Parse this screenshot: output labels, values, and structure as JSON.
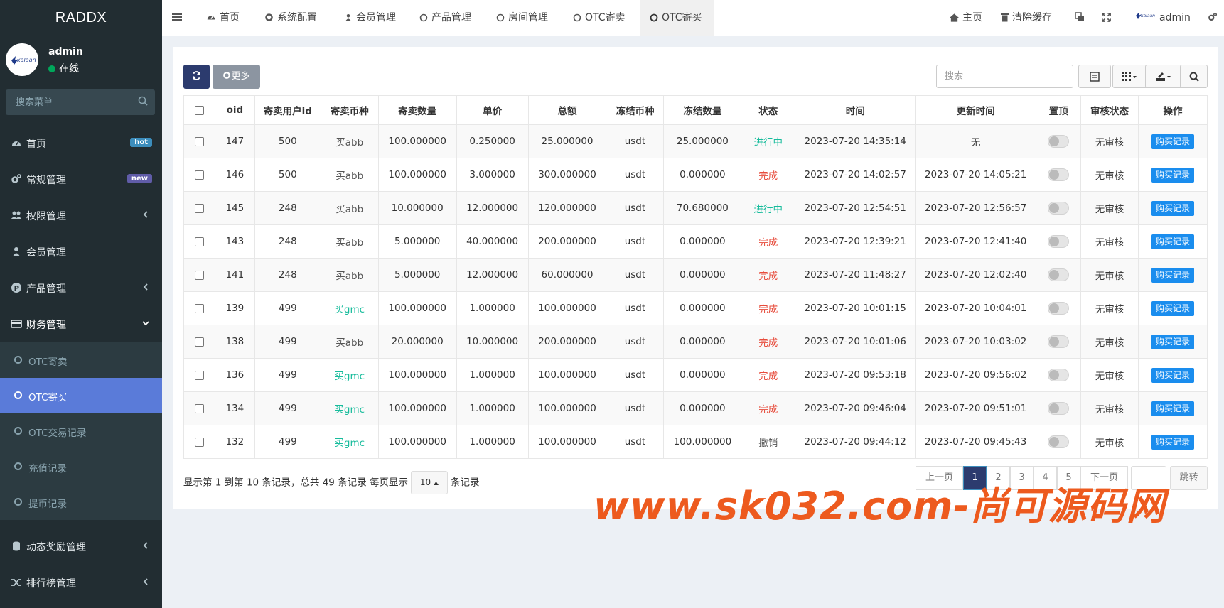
{
  "app": {
    "title": "RADDX"
  },
  "user": {
    "name": "admin",
    "status": "在线"
  },
  "sidebar": {
    "search_placeholder": "搜索菜单",
    "items": [
      {
        "label": "首页",
        "badge": "hot",
        "badge_color": "#3c8dbc"
      },
      {
        "label": "常规管理",
        "badge": "new",
        "badge_color": "#605ca8"
      },
      {
        "label": "权限管理"
      },
      {
        "label": "会员管理"
      },
      {
        "label": "产品管理"
      },
      {
        "label": "财务管理"
      }
    ],
    "sub_items": [
      {
        "label": "OTC寄卖"
      },
      {
        "label": "OTC寄买"
      },
      {
        "label": "OTC交易记录"
      },
      {
        "label": "充值记录"
      },
      {
        "label": "提币记录"
      }
    ],
    "bottom_items": [
      {
        "label": "动态奖励管理"
      },
      {
        "label": "排行榜管理"
      }
    ]
  },
  "topnav": {
    "tabs": [
      {
        "label": "首页"
      },
      {
        "label": "系统配置"
      },
      {
        "label": "会员管理"
      },
      {
        "label": "产品管理"
      },
      {
        "label": "房间管理"
      },
      {
        "label": "OTC寄卖"
      },
      {
        "label": "OTC寄买"
      }
    ],
    "right": {
      "home": "主页",
      "clear_cache": "清除缓存",
      "user": "admin"
    }
  },
  "toolbar": {
    "more_label": "更多",
    "search_placeholder": "搜索"
  },
  "table": {
    "headers": [
      "oid",
      "寄卖用户id",
      "寄卖币种",
      "寄卖数量",
      "单价",
      "总额",
      "冻结币种",
      "冻结数量",
      "状态",
      "时间",
      "更新时间",
      "置顶",
      "审核状态",
      "操作"
    ],
    "rows": [
      {
        "oid": "147",
        "uid": "500",
        "coin": "买abb",
        "coin_type": "abb",
        "qty": "100.000000",
        "price": "0.250000",
        "total": "25.000000",
        "fcoin": "usdt",
        "fqty": "25.000000",
        "status": "进行中",
        "status_type": "progress",
        "time": "2023-07-20 14:35:14",
        "utime": "无",
        "audit": "无审核",
        "op": "购买记录"
      },
      {
        "oid": "146",
        "uid": "500",
        "coin": "买abb",
        "coin_type": "abb",
        "qty": "100.000000",
        "price": "3.000000",
        "total": "300.000000",
        "fcoin": "usdt",
        "fqty": "0.000000",
        "status": "完成",
        "status_type": "done",
        "time": "2023-07-20 14:02:57",
        "utime": "2023-07-20 14:05:21",
        "audit": "无审核",
        "op": "购买记录"
      },
      {
        "oid": "145",
        "uid": "248",
        "coin": "买abb",
        "coin_type": "abb",
        "qty": "10.000000",
        "price": "12.000000",
        "total": "120.000000",
        "fcoin": "usdt",
        "fqty": "70.680000",
        "status": "进行中",
        "status_type": "progress",
        "time": "2023-07-20 12:54:51",
        "utime": "2023-07-20 12:56:57",
        "audit": "无审核",
        "op": "购买记录"
      },
      {
        "oid": "143",
        "uid": "248",
        "coin": "买abb",
        "coin_type": "abb",
        "qty": "5.000000",
        "price": "40.000000",
        "total": "200.000000",
        "fcoin": "usdt",
        "fqty": "0.000000",
        "status": "完成",
        "status_type": "done",
        "time": "2023-07-20 12:39:21",
        "utime": "2023-07-20 12:41:40",
        "audit": "无审核",
        "op": "购买记录"
      },
      {
        "oid": "141",
        "uid": "248",
        "coin": "买abb",
        "coin_type": "abb",
        "qty": "5.000000",
        "price": "12.000000",
        "total": "60.000000",
        "fcoin": "usdt",
        "fqty": "0.000000",
        "status": "完成",
        "status_type": "done",
        "time": "2023-07-20 11:48:27",
        "utime": "2023-07-20 12:02:40",
        "audit": "无审核",
        "op": "购买记录"
      },
      {
        "oid": "139",
        "uid": "499",
        "coin": "买gmc",
        "coin_type": "gmc",
        "qty": "100.000000",
        "price": "1.000000",
        "total": "100.000000",
        "fcoin": "usdt",
        "fqty": "0.000000",
        "status": "完成",
        "status_type": "done",
        "time": "2023-07-20 10:01:15",
        "utime": "2023-07-20 10:04:01",
        "audit": "无审核",
        "op": "购买记录"
      },
      {
        "oid": "138",
        "uid": "499",
        "coin": "买abb",
        "coin_type": "abb",
        "qty": "20.000000",
        "price": "10.000000",
        "total": "200.000000",
        "fcoin": "usdt",
        "fqty": "0.000000",
        "status": "完成",
        "status_type": "done",
        "time": "2023-07-20 10:01:06",
        "utime": "2023-07-20 10:03:02",
        "audit": "无审核",
        "op": "购买记录"
      },
      {
        "oid": "136",
        "uid": "499",
        "coin": "买gmc",
        "coin_type": "gmc",
        "qty": "100.000000",
        "price": "1.000000",
        "total": "100.000000",
        "fcoin": "usdt",
        "fqty": "0.000000",
        "status": "完成",
        "status_type": "done",
        "time": "2023-07-20 09:53:18",
        "utime": "2023-07-20 09:56:02",
        "audit": "无审核",
        "op": "购买记录"
      },
      {
        "oid": "134",
        "uid": "499",
        "coin": "买gmc",
        "coin_type": "gmc",
        "qty": "100.000000",
        "price": "1.000000",
        "total": "100.000000",
        "fcoin": "usdt",
        "fqty": "0.000000",
        "status": "完成",
        "status_type": "done",
        "time": "2023-07-20 09:46:04",
        "utime": "2023-07-20 09:51:01",
        "audit": "无审核",
        "op": "购买记录"
      },
      {
        "oid": "132",
        "uid": "499",
        "coin": "买gmc",
        "coin_type": "gmc",
        "qty": "100.000000",
        "price": "1.000000",
        "total": "100.000000",
        "fcoin": "usdt",
        "fqty": "100.000000",
        "status": "撤销",
        "status_type": "cancel",
        "time": "2023-07-20 09:44:12",
        "utime": "2023-07-20 09:45:43",
        "audit": "无审核",
        "op": "购买记录"
      }
    ]
  },
  "pagination": {
    "info_prefix": "显示第 1 到第 10 条记录，总共 49 条记录 每页显示",
    "page_size": "10",
    "info_suffix": "条记录",
    "prev": "上一页",
    "pages": [
      "1",
      "2",
      "3",
      "4",
      "5"
    ],
    "current": "1",
    "next": "下一页",
    "jump": "跳转"
  },
  "watermark": {
    "text": "www.sk032.com-尚可源码网"
  },
  "colors": {
    "sidebar": "#222d32",
    "active": "#5a7bd9",
    "green": "#18bc9c",
    "red": "#e74c3c",
    "record_btn": "#1a8dee"
  }
}
